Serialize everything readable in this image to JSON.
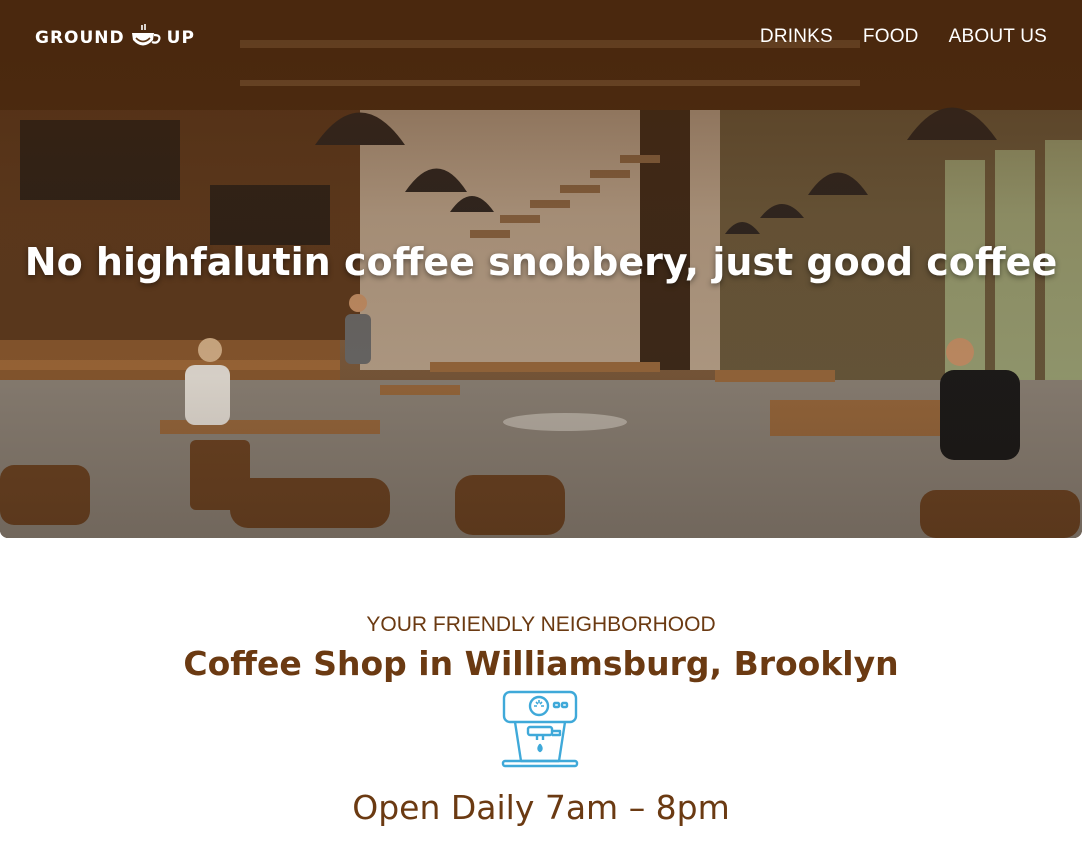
{
  "brand": {
    "logo_left": "GROUND",
    "logo_right": "UP",
    "logo_icon": "coffee-cup-icon"
  },
  "nav": {
    "items": [
      {
        "label": "DRINKS"
      },
      {
        "label": "FOOD"
      },
      {
        "label": "ABOUT US"
      }
    ]
  },
  "hero": {
    "title": "No highfalutin coffee snobbery, just good coffee"
  },
  "info": {
    "tagline": "YOUR FRIENDLY NEIGHBORHOOD",
    "heading": "Coffee Shop in Williamsburg, Brooklyn",
    "icon": "espresso-machine-icon",
    "hours": "Open Daily 7am – 8pm"
  },
  "colors": {
    "brand_brown": "#6b3a12",
    "icon_blue": "#3fa9d9",
    "white": "#ffffff"
  }
}
